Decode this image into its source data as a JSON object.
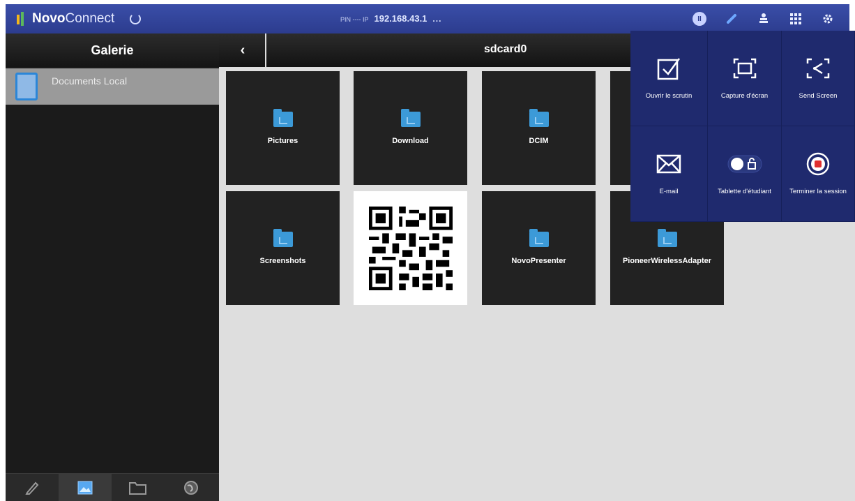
{
  "topbar": {
    "brand_bold": "Novo",
    "brand_rest": "Connect",
    "pin_label": "PIN ---- IP",
    "ip": "192.168.43.1",
    "more": "...",
    "accent": "#2c3c8e"
  },
  "sidebar": {
    "title": "Galerie",
    "items": [
      {
        "label": "Documents Local"
      }
    ],
    "bottom_tabs": [
      "pencil-icon",
      "gallery-icon",
      "folder-icon",
      "globe-icon"
    ]
  },
  "main": {
    "path": "sdcard0",
    "tiles": [
      {
        "label": "Pictures",
        "kind": "folder"
      },
      {
        "label": "Download",
        "kind": "folder"
      },
      {
        "label": "DCIM",
        "kind": "folder"
      },
      {
        "label": "Screenshots",
        "kind": "folder"
      },
      {
        "label": "",
        "kind": "qr"
      },
      {
        "label": "NovoPresenter",
        "kind": "folder"
      },
      {
        "label": "PioneerWirelessAdapter",
        "kind": "folder"
      }
    ]
  },
  "popup": {
    "items": [
      {
        "label": "Ouvrir le scrutin",
        "icon": "checkbox-icon"
      },
      {
        "label": "Capture d'écran",
        "icon": "capture-icon"
      },
      {
        "label": "Send Screen",
        "icon": "send-screen-icon"
      },
      {
        "label": "E-mail",
        "icon": "mail-icon"
      },
      {
        "label": "Tablette d'étudiant",
        "icon": "lock-toggle-icon"
      },
      {
        "label": "Terminer la session",
        "icon": "stop-icon"
      }
    ]
  }
}
